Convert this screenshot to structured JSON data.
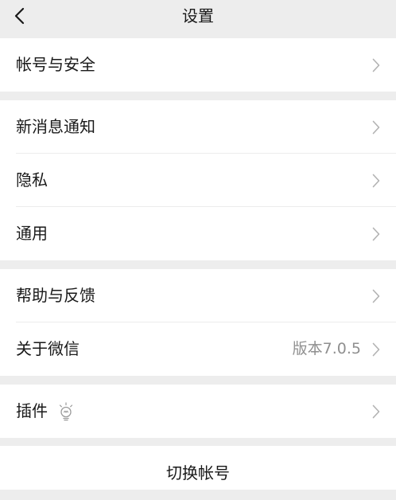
{
  "nav": {
    "title": "设置",
    "back_icon": "chevron-left-icon"
  },
  "groups": [
    {
      "items": [
        {
          "label": "帐号与安全"
        }
      ]
    },
    {
      "items": [
        {
          "label": "新消息通知"
        },
        {
          "label": "隐私"
        },
        {
          "label": "通用"
        }
      ]
    },
    {
      "items": [
        {
          "label": "帮助与反馈"
        },
        {
          "label": "关于微信",
          "value": "版本7.0.5"
        }
      ]
    },
    {
      "items": [
        {
          "label": "插件",
          "icon": "lightbulb-icon"
        }
      ]
    }
  ],
  "switch_account": {
    "label": "切换帐号"
  },
  "colors": {
    "background": "#ededed",
    "card": "#ffffff",
    "text": "#191919",
    "secondary_text": "#8f8f8f",
    "chevron": "#b2b2b2"
  }
}
